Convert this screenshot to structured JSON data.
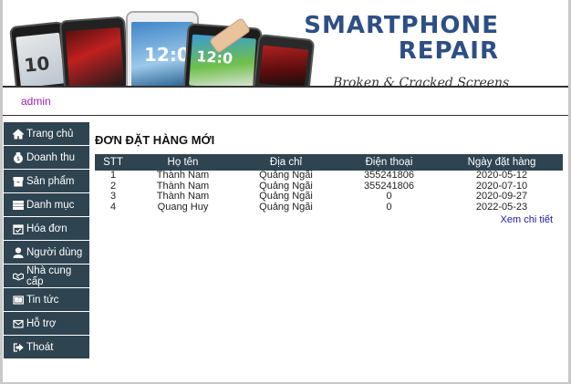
{
  "banner": {
    "brand_line1": "SMARTPHONE",
    "brand_line2": "REPAIR",
    "tagline": "Broken & Cracked Screens"
  },
  "user": {
    "name": "admin"
  },
  "sidebar": {
    "items": [
      {
        "label": "Trang chủ",
        "icon": "home-icon"
      },
      {
        "label": "Doanh thu",
        "icon": "money-bag-icon"
      },
      {
        "label": "Sản phẩm",
        "icon": "box-icon"
      },
      {
        "label": "Danh mục",
        "icon": "list-icon"
      },
      {
        "label": "Hóa đơn",
        "icon": "calendar-check-icon"
      },
      {
        "label": "Người dùng",
        "icon": "user-icon"
      },
      {
        "label": "Nhà cung cấp",
        "icon": "handshake-icon"
      },
      {
        "label": "Tin tức",
        "icon": "newspaper-icon"
      },
      {
        "label": "Hỗ trợ",
        "icon": "envelope-icon"
      },
      {
        "label": "Thoát",
        "icon": "sign-out-icon"
      }
    ]
  },
  "main": {
    "title": "ĐƠN ĐẶT HÀNG MỚI",
    "table": {
      "headers": [
        "STT",
        "Họ tên",
        "Địa chỉ",
        "Điện thoại",
        "Ngày đặt hàng"
      ],
      "rows": [
        [
          "1",
          "Thành Nam",
          "Quảng Ngãi",
          "355241806",
          "2020-05-12"
        ],
        [
          "2",
          "Thành Nam",
          "Quảng Ngãi",
          "355241806",
          "2020-07-10"
        ],
        [
          "3",
          "Thành Nam",
          "Quảng Ngãi",
          "0",
          "2020-09-27"
        ],
        [
          "4",
          "Quang Huy",
          "Quảng Ngãi",
          "0",
          "2022-05-23"
        ]
      ]
    },
    "details_link": "Xem chi tiết"
  },
  "colors": {
    "sidebar_bg": "#2f4451",
    "table_header_bg": "#2f4451",
    "brand": "#2d4f86",
    "username": "#9b1fae",
    "link": "#1a1aa6"
  }
}
